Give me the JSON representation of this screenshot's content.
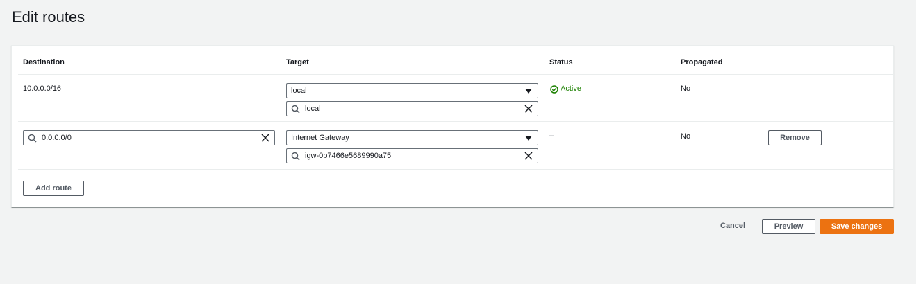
{
  "page": {
    "title": "Edit routes"
  },
  "table": {
    "headers": {
      "destination": "Destination",
      "target": "Target",
      "status": "Status",
      "propagated": "Propagated"
    },
    "rows": [
      {
        "destination": "10.0.0.0/16",
        "target_type": "local",
        "target_value": "local",
        "status": "Active",
        "propagated": "No"
      },
      {
        "destination": "0.0.0.0/0",
        "target_type": "Internet Gateway",
        "target_value": "igw-0b7466e5689990a75",
        "status": "–",
        "propagated": "No",
        "remove_label": "Remove"
      }
    ],
    "add_route_label": "Add route"
  },
  "footer": {
    "cancel_label": "Cancel",
    "preview_label": "Preview",
    "save_label": "Save changes"
  },
  "colors": {
    "primary": "#ec7211",
    "success": "#1d8102",
    "border": "#687078",
    "background": "#f2f3f3"
  }
}
